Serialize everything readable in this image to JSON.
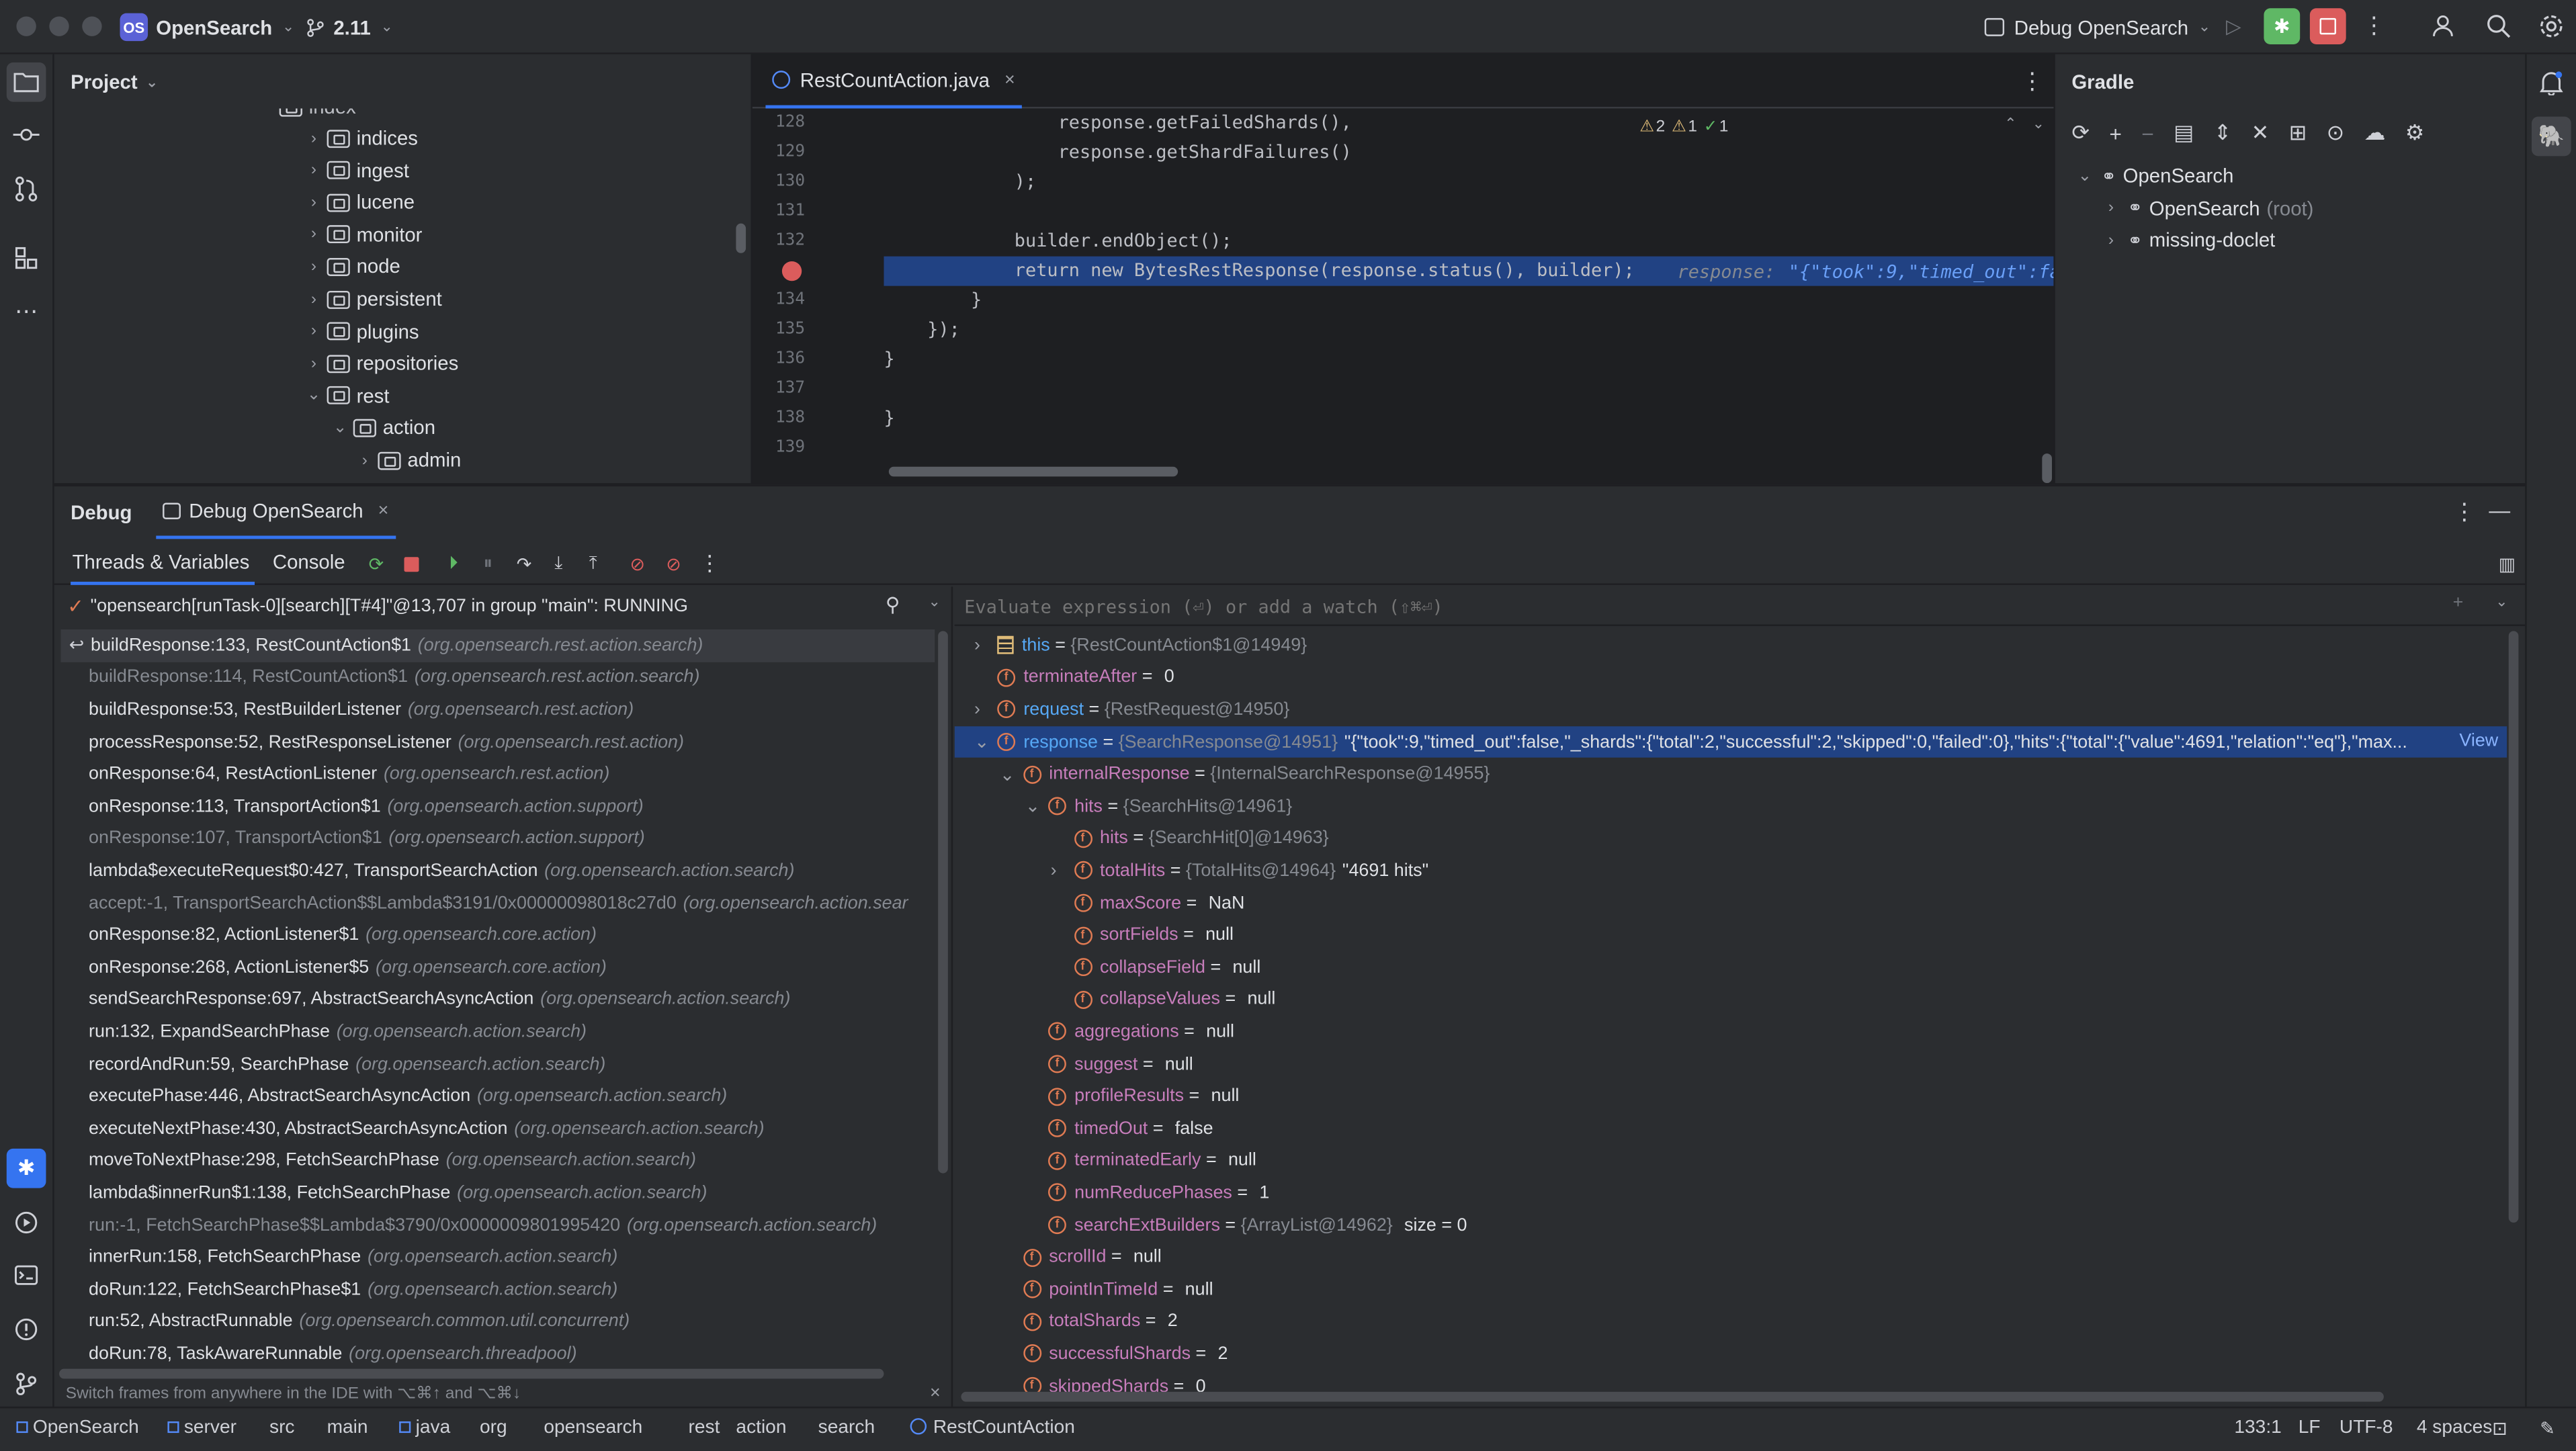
{
  "titlebar": {
    "project_badge": "OS",
    "project": "OpenSearch",
    "branch": "2.11",
    "run_config": "Debug OpenSearch"
  },
  "project_panel": {
    "title": "Project",
    "items": [
      {
        "label": "indices",
        "depth": 1,
        "expanded": false
      },
      {
        "label": "ingest",
        "depth": 1,
        "expanded": false
      },
      {
        "label": "lucene",
        "depth": 1,
        "expanded": false
      },
      {
        "label": "monitor",
        "depth": 1,
        "expanded": false
      },
      {
        "label": "node",
        "depth": 1,
        "expanded": false
      },
      {
        "label": "persistent",
        "depth": 1,
        "expanded": false
      },
      {
        "label": "plugins",
        "depth": 1,
        "expanded": false
      },
      {
        "label": "repositories",
        "depth": 1,
        "expanded": false
      },
      {
        "label": "rest",
        "depth": 1,
        "expanded": true
      },
      {
        "label": "action",
        "depth": 2,
        "expanded": true
      },
      {
        "label": "admin",
        "depth": 3,
        "expanded": false
      }
    ]
  },
  "editor": {
    "tab": "RestCountAction.java",
    "warnings": "2",
    "weak_warnings": "1",
    "checks": "1",
    "lines": [
      {
        "num": "128",
        "text": "                response.getFailedShards(),"
      },
      {
        "num": "129",
        "text": "                response.getShardFailures()"
      },
      {
        "num": "130",
        "text": "            );"
      },
      {
        "num": "131",
        "text": ""
      },
      {
        "num": "132",
        "text": "            builder.endObject();"
      },
      {
        "num": "",
        "text": "            return new BytesRestResponse(response.status(), builder);"
      },
      {
        "num": "134",
        "text": "        }"
      },
      {
        "num": "135",
        "text": "    });"
      },
      {
        "num": "136",
        "text": "}"
      },
      {
        "num": "137",
        "text": ""
      },
      {
        "num": "138",
        "text": "}"
      },
      {
        "num": "139",
        "text": ""
      }
    ],
    "inline_hint_label": "response:",
    "inline_hint_value": "\"{\"took\":9,\"timed_out\":fal"
  },
  "gradle": {
    "title": "Gradle",
    "items": [
      {
        "label": "OpenSearch",
        "suffix": "",
        "depth": 0
      },
      {
        "label": "OpenSearch",
        "suffix": "(root)",
        "depth": 1
      },
      {
        "label": "missing-doclet",
        "suffix": "",
        "depth": 1
      }
    ]
  },
  "debug": {
    "title": "Debug",
    "session_tab": "Debug OpenSearch",
    "tab_threads": "Threads & Variables",
    "tab_console": "Console",
    "thread": "\"opensearch[runTask-0][search][T#4]\"@13,707 in group \"main\": RUNNING",
    "watch_placeholder": "Evaluate expression (⏎) or add a watch (⇧⌘⏎)",
    "frames": [
      {
        "method": "buildResponse:133, RestCountAction$1",
        "pkg": "(org.opensearch.rest.action.search)",
        "dim": false
      },
      {
        "method": "buildResponse:114, RestCountAction$1",
        "pkg": "(org.opensearch.rest.action.search)",
        "dim": true
      },
      {
        "method": "buildResponse:53, RestBuilderListener",
        "pkg": "(org.opensearch.rest.action)",
        "dim": false
      },
      {
        "method": "processResponse:52, RestResponseListener",
        "pkg": "(org.opensearch.rest.action)",
        "dim": false
      },
      {
        "method": "onResponse:64, RestActionListener",
        "pkg": "(org.opensearch.rest.action)",
        "dim": false
      },
      {
        "method": "onResponse:113, TransportAction$1",
        "pkg": "(org.opensearch.action.support)",
        "dim": false
      },
      {
        "method": "onResponse:107, TransportAction$1",
        "pkg": "(org.opensearch.action.support)",
        "dim": true
      },
      {
        "method": "lambda$executeRequest$0:427, TransportSearchAction",
        "pkg": "(org.opensearch.action.search)",
        "dim": false
      },
      {
        "method": "accept:-1, TransportSearchAction$$Lambda$3191/0x00000098018c27d0",
        "pkg": "(org.opensearch.action.sear",
        "dim": true
      },
      {
        "method": "onResponse:82, ActionListener$1",
        "pkg": "(org.opensearch.core.action)",
        "dim": false
      },
      {
        "method": "onResponse:268, ActionListener$5",
        "pkg": "(org.opensearch.core.action)",
        "dim": false
      },
      {
        "method": "sendSearchResponse:697, AbstractSearchAsyncAction",
        "pkg": "(org.opensearch.action.search)",
        "dim": false
      },
      {
        "method": "run:132, ExpandSearchPhase",
        "pkg": "(org.opensearch.action.search)",
        "dim": false
      },
      {
        "method": "recordAndRun:59, SearchPhase",
        "pkg": "(org.opensearch.action.search)",
        "dim": false
      },
      {
        "method": "executePhase:446, AbstractSearchAsyncAction",
        "pkg": "(org.opensearch.action.search)",
        "dim": false
      },
      {
        "method": "executeNextPhase:430, AbstractSearchAsyncAction",
        "pkg": "(org.opensearch.action.search)",
        "dim": false
      },
      {
        "method": "moveToNextPhase:298, FetchSearchPhase",
        "pkg": "(org.opensearch.action.search)",
        "dim": false
      },
      {
        "method": "lambda$innerRun$1:138, FetchSearchPhase",
        "pkg": "(org.opensearch.action.search)",
        "dim": false
      },
      {
        "method": "run:-1, FetchSearchPhase$$Lambda$3790/0x0000009801995420",
        "pkg": "(org.opensearch.action.search)",
        "dim": true
      },
      {
        "method": "innerRun:158, FetchSearchPhase",
        "pkg": "(org.opensearch.action.search)",
        "dim": false
      },
      {
        "method": "doRun:122, FetchSearchPhase$1",
        "pkg": "(org.opensearch.action.search)",
        "dim": false
      },
      {
        "method": "run:52, AbstractRunnable",
        "pkg": "(org.opensearch.common.util.concurrent)",
        "dim": false
      },
      {
        "method": "doRun:78, TaskAwareRunnable",
        "pkg": "(org.opensearch.threadpool)",
        "dim": false
      }
    ],
    "frames_hint": "Switch frames from anywhere in the IDE with ⌥⌘↑ and ⌥⌘↓",
    "variables": [
      {
        "depth": 0,
        "toggle": "›",
        "kind": "this",
        "name": "this",
        "eq": " = ",
        "type": "{RestCountAction$1@14949}",
        "value": ""
      },
      {
        "depth": 0,
        "toggle": "",
        "kind": "f",
        "name": "terminateAfter",
        "eq": " = ",
        "type": "",
        "value": "0"
      },
      {
        "depth": 0,
        "toggle": "›",
        "kind": "p",
        "name": "request",
        "eq": " = ",
        "type": "{RestRequest@14950}",
        "value": ""
      },
      {
        "depth": 0,
        "toggle": "⌄",
        "kind": "p",
        "name": "response",
        "eq": " = ",
        "type": "{SearchResponse@14951}",
        "value": "\"{\"took\":9,\"timed_out\":false,\"_shards\":{\"total\":2,\"successful\":2,\"skipped\":0,\"failed\":0},\"hits\":{\"total\":{\"value\":4691,\"relation\":\"eq\"},\"max...",
        "link": "View",
        "selected": true
      },
      {
        "depth": 1,
        "toggle": "⌄",
        "kind": "f",
        "name": "internalResponse",
        "eq": " = ",
        "type": "{InternalSearchResponse@14955}",
        "value": ""
      },
      {
        "depth": 2,
        "toggle": "⌄",
        "kind": "f",
        "name": "hits",
        "eq": " = ",
        "type": "{SearchHits@14961}",
        "value": ""
      },
      {
        "depth": 3,
        "toggle": "",
        "kind": "f",
        "name": "hits",
        "eq": " = ",
        "type": "{SearchHit[0]@14963}",
        "value": ""
      },
      {
        "depth": 3,
        "toggle": "›",
        "kind": "f",
        "name": "totalHits",
        "eq": " = ",
        "type": "{TotalHits@14964}",
        "value": "\"4691 hits\""
      },
      {
        "depth": 3,
        "toggle": "",
        "kind": "f",
        "name": "maxScore",
        "eq": " = ",
        "type": "",
        "value": "NaN"
      },
      {
        "depth": 3,
        "toggle": "",
        "kind": "f",
        "name": "sortFields",
        "eq": " = ",
        "type": "",
        "value": "null"
      },
      {
        "depth": 3,
        "toggle": "",
        "kind": "f",
        "name": "collapseField",
        "eq": " = ",
        "type": "",
        "value": "null"
      },
      {
        "depth": 3,
        "toggle": "",
        "kind": "f",
        "name": "collapseValues",
        "eq": " = ",
        "type": "",
        "value": "null"
      },
      {
        "depth": 2,
        "toggle": "",
        "kind": "f",
        "name": "aggregations",
        "eq": " = ",
        "type": "",
        "value": "null"
      },
      {
        "depth": 2,
        "toggle": "",
        "kind": "f",
        "name": "suggest",
        "eq": " = ",
        "type": "",
        "value": "null"
      },
      {
        "depth": 2,
        "toggle": "",
        "kind": "f",
        "name": "profileResults",
        "eq": " = ",
        "type": "",
        "value": "null"
      },
      {
        "depth": 2,
        "toggle": "",
        "kind": "f",
        "name": "timedOut",
        "eq": " = ",
        "type": "",
        "value": "false"
      },
      {
        "depth": 2,
        "toggle": "",
        "kind": "f",
        "name": "terminatedEarly",
        "eq": " = ",
        "type": "",
        "value": "null"
      },
      {
        "depth": 2,
        "toggle": "",
        "kind": "f",
        "name": "numReducePhases",
        "eq": " = ",
        "type": "",
        "value": "1"
      },
      {
        "depth": 2,
        "toggle": "",
        "kind": "f",
        "name": "searchExtBuilders",
        "eq": " = ",
        "type": "{ArrayList@14962}",
        "value": " size = 0"
      },
      {
        "depth": 1,
        "toggle": "",
        "kind": "f",
        "name": "scrollId",
        "eq": " = ",
        "type": "",
        "value": "null"
      },
      {
        "depth": 1,
        "toggle": "",
        "kind": "f",
        "name": "pointInTimeId",
        "eq": " = ",
        "type": "",
        "value": "null"
      },
      {
        "depth": 1,
        "toggle": "",
        "kind": "f",
        "name": "totalShards",
        "eq": " = ",
        "type": "",
        "value": "2"
      },
      {
        "depth": 1,
        "toggle": "",
        "kind": "f",
        "name": "successfulShards",
        "eq": " = ",
        "type": "",
        "value": "2"
      },
      {
        "depth": 1,
        "toggle": "",
        "kind": "f",
        "name": "skippedShards",
        "eq": " = ",
        "type": "",
        "value": "0"
      }
    ]
  },
  "statusbar": {
    "crumbs": [
      "OpenSearch",
      "server",
      "src",
      "main",
      "java",
      "org",
      "opensearch",
      "rest",
      "action",
      "search",
      "RestCountAction"
    ],
    "position": "133:1",
    "line_sep": "LF",
    "encoding": "UTF-8",
    "indent": "4 spaces"
  },
  "colors": {
    "accent": "#3574f0",
    "selection": "#214283",
    "stop": "#db5c5c",
    "run": "#5fb865"
  }
}
